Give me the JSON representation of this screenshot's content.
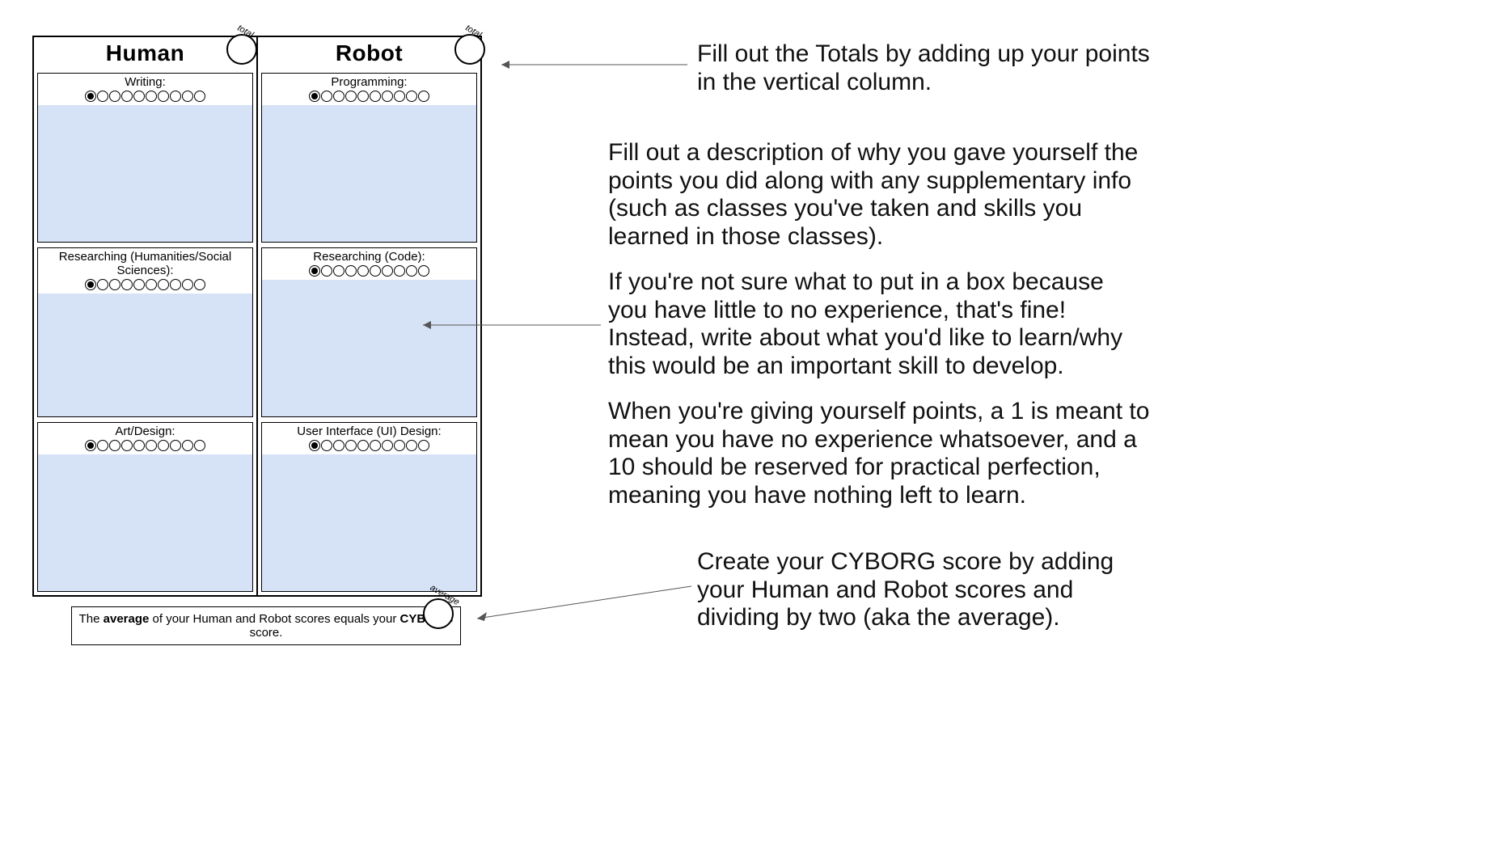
{
  "worksheet": {
    "columns": [
      {
        "header": "Human",
        "total_label": "total",
        "skills": [
          {
            "label": "Writing:",
            "dots": 10,
            "selected_index": 0
          },
          {
            "label": "Researching (Humanities/Social Sciences):",
            "dots": 10,
            "selected_index": 0
          },
          {
            "label": "Art/Design:",
            "dots": 10,
            "selected_index": 0
          }
        ]
      },
      {
        "header": "Robot",
        "total_label": "total",
        "skills": [
          {
            "label": "Programming:",
            "dots": 10,
            "selected_index": 0
          },
          {
            "label": "Researching (Code):",
            "dots": 10,
            "selected_index": 0
          },
          {
            "label": "User Interface (UI) Design:",
            "dots": 10,
            "selected_index": 0
          }
        ]
      }
    ]
  },
  "footer": {
    "pre": "The ",
    "b1": "average",
    "mid": " of your Human and Robot scores equals your ",
    "b2": "CYBORG",
    "post": " score.",
    "avg_label": "average"
  },
  "instructions": {
    "p1": "Fill out the Totals by adding up your points in the vertical column.",
    "p2": "Fill out a description of why you gave yourself the points you did along with any supplementary info (such as classes you've taken and skills you learned in those classes).",
    "p3": "If you're not sure what to put in a box because you have little to no experience, that's fine! Instead, write about what you'd like to learn/why this would be an important skill to develop.",
    "p4": "When you're giving yourself points, a 1 is meant to mean you have no experience whatsoever, and a 10 should be reserved for practical perfection, meaning you have nothing left to learn.",
    "p5": "Create your CYBORG score by adding your Human and Robot scores and dividing by two (aka the average)."
  }
}
